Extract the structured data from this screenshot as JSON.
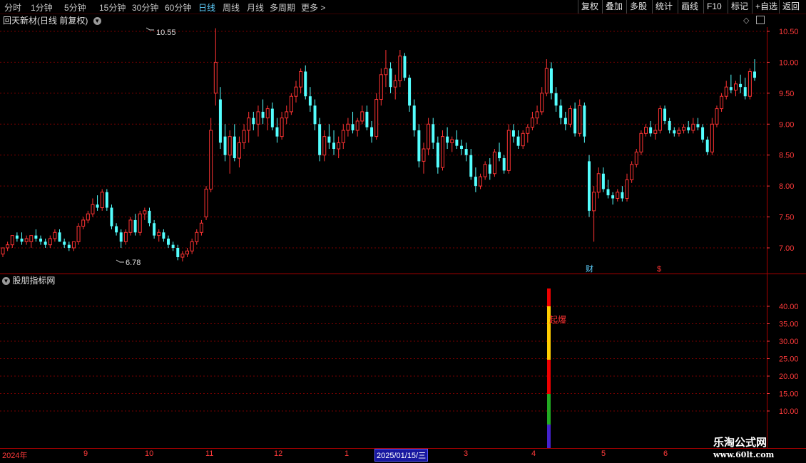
{
  "toolbar": {
    "periods": [
      "分时",
      "1分钟",
      "5分钟",
      "15分钟",
      "30分钟",
      "60分钟",
      "日线",
      "周线",
      "月线",
      "多周期",
      "更多 >"
    ],
    "active": "日线",
    "actions": [
      "复权",
      "叠加",
      "多股",
      "统计",
      "画线",
      "F10",
      "标记",
      "+自选",
      "返回"
    ]
  },
  "main": {
    "title": "回天新材(日线 前复权)",
    "price_labels": [
      "10.50",
      "10.00",
      "9.50",
      "9.00",
      "8.50",
      "8.00",
      "7.50",
      "7.00"
    ],
    "high_note": "10.55",
    "low_note": "6.78",
    "markers": [
      "财",
      "$"
    ]
  },
  "indicator": {
    "title": "股朋指标网",
    "labels": [
      "40.00",
      "35.00",
      "30.00",
      "25.00",
      "20.00",
      "15.00",
      "10.00"
    ],
    "signal_text": "起爆"
  },
  "xaxis": {
    "labels": [
      "2024年",
      "9",
      "10",
      "11",
      "12",
      "1",
      "2025/01/15/三",
      "3",
      "4",
      "5",
      "6"
    ]
  },
  "watermark": {
    "line1": "乐淘公式网",
    "line2": "www.60lt.com"
  },
  "colors": {
    "up": "#ff3333",
    "down": "#54ffff",
    "axis": "#ff3a3a",
    "grid": "#7a0000"
  },
  "candles": [
    [
      6.9,
      7.0,
      6.85,
      7.0
    ],
    [
      7.0,
      7.1,
      6.95,
      7.05
    ],
    [
      7.05,
      7.2,
      7.0,
      7.2
    ],
    [
      7.2,
      7.25,
      7.1,
      7.15
    ],
    [
      7.15,
      7.25,
      7.05,
      7.1
    ],
    [
      7.1,
      7.2,
      7.05,
      7.15
    ],
    [
      7.1,
      7.2,
      7.0,
      7.2
    ],
    [
      7.2,
      7.3,
      7.1,
      7.15
    ],
    [
      7.15,
      7.2,
      7.05,
      7.1
    ],
    [
      7.1,
      7.15,
      7.0,
      7.05
    ],
    [
      7.05,
      7.2,
      7.0,
      7.15
    ],
    [
      7.15,
      7.3,
      7.1,
      7.25
    ],
    [
      7.25,
      7.3,
      7.1,
      7.1
    ],
    [
      7.1,
      7.15,
      7.0,
      7.05
    ],
    [
      7.05,
      7.1,
      6.95,
      7.0
    ],
    [
      7.0,
      7.1,
      6.95,
      7.1
    ],
    [
      7.1,
      7.4,
      7.05,
      7.35
    ],
    [
      7.35,
      7.5,
      7.3,
      7.45
    ],
    [
      7.45,
      7.6,
      7.4,
      7.55
    ],
    [
      7.55,
      7.8,
      7.5,
      7.7
    ],
    [
      7.7,
      7.85,
      7.6,
      7.65
    ],
    [
      7.65,
      7.95,
      7.6,
      7.9
    ],
    [
      7.9,
      7.95,
      7.6,
      7.65
    ],
    [
      7.65,
      7.7,
      7.3,
      7.35
    ],
    [
      7.35,
      7.4,
      7.2,
      7.25
    ],
    [
      7.25,
      7.3,
      7.0,
      7.1
    ],
    [
      7.1,
      7.3,
      7.05,
      7.25
    ],
    [
      7.25,
      7.5,
      7.2,
      7.45
    ],
    [
      7.45,
      7.55,
      7.2,
      7.25
    ],
    [
      7.25,
      7.6,
      7.2,
      7.55
    ],
    [
      7.55,
      7.65,
      7.45,
      7.6
    ],
    [
      7.6,
      7.65,
      7.35,
      7.4
    ],
    [
      7.4,
      7.45,
      7.15,
      7.2
    ],
    [
      7.2,
      7.3,
      7.1,
      7.25
    ],
    [
      7.25,
      7.3,
      7.1,
      7.15
    ],
    [
      7.15,
      7.2,
      7.0,
      7.05
    ],
    [
      7.05,
      7.1,
      6.95,
      7.0
    ],
    [
      7.0,
      7.05,
      6.8,
      6.85
    ],
    [
      6.85,
      6.95,
      6.78,
      6.9
    ],
    [
      6.9,
      7.0,
      6.85,
      6.95
    ],
    [
      6.95,
      7.15,
      6.9,
      7.1
    ],
    [
      7.1,
      7.3,
      7.05,
      7.25
    ],
    [
      7.25,
      7.45,
      7.2,
      7.4
    ],
    [
      7.5,
      8.0,
      7.45,
      7.95
    ],
    [
      7.95,
      9.1,
      7.9,
      8.9
    ],
    [
      9.5,
      10.55,
      9.3,
      10.0
    ],
    [
      9.4,
      9.6,
      8.6,
      8.7
    ],
    [
      8.8,
      9.0,
      8.4,
      8.5
    ],
    [
      8.5,
      8.9,
      8.2,
      8.8
    ],
    [
      8.8,
      9.0,
      8.4,
      8.45
    ],
    [
      8.45,
      8.8,
      8.3,
      8.7
    ],
    [
      8.7,
      9.0,
      8.6,
      8.9
    ],
    [
      8.9,
      9.2,
      8.7,
      9.1
    ],
    [
      9.1,
      9.2,
      8.9,
      9.0
    ],
    [
      9.0,
      9.3,
      8.8,
      9.2
    ],
    [
      9.2,
      9.4,
      9.0,
      9.1
    ],
    [
      9.1,
      9.3,
      8.9,
      9.25
    ],
    [
      9.25,
      9.35,
      8.9,
      8.95
    ],
    [
      8.95,
      9.1,
      8.7,
      8.8
    ],
    [
      8.8,
      9.2,
      8.75,
      9.1
    ],
    [
      9.1,
      9.3,
      9.0,
      9.2
    ],
    [
      9.2,
      9.5,
      9.15,
      9.45
    ],
    [
      9.45,
      9.7,
      9.35,
      9.6
    ],
    [
      9.6,
      9.9,
      9.5,
      9.85
    ],
    [
      9.85,
      9.95,
      9.4,
      9.45
    ],
    [
      9.45,
      9.6,
      9.2,
      9.3
    ],
    [
      9.3,
      9.4,
      8.9,
      9.0
    ],
    [
      9.0,
      9.1,
      8.4,
      8.5
    ],
    [
      8.5,
      8.9,
      8.4,
      8.8
    ],
    [
      8.8,
      9.0,
      8.6,
      8.7
    ],
    [
      8.7,
      8.9,
      8.5,
      8.6
    ],
    [
      8.6,
      8.8,
      8.45,
      8.7
    ],
    [
      8.7,
      9.0,
      8.6,
      8.9
    ],
    [
      8.9,
      9.1,
      8.8,
      9.0
    ],
    [
      9.0,
      9.2,
      8.85,
      8.9
    ],
    [
      8.9,
      9.1,
      8.8,
      9.05
    ],
    [
      9.05,
      9.3,
      9.0,
      9.2
    ],
    [
      9.2,
      9.3,
      8.9,
      8.95
    ],
    [
      8.95,
      9.05,
      8.7,
      8.8
    ],
    [
      8.8,
      9.5,
      8.75,
      9.4
    ],
    [
      9.4,
      9.9,
      9.3,
      9.8
    ],
    [
      9.8,
      10.2,
      9.6,
      9.9
    ],
    [
      9.9,
      10.0,
      9.5,
      9.6
    ],
    [
      9.6,
      9.8,
      9.4,
      9.7
    ],
    [
      9.7,
      10.2,
      9.6,
      10.1
    ],
    [
      10.1,
      10.15,
      9.7,
      9.75
    ],
    [
      9.75,
      9.8,
      9.2,
      9.3
    ],
    [
      9.3,
      9.4,
      8.8,
      8.9
    ],
    [
      8.9,
      9.0,
      8.3,
      8.4
    ],
    [
      8.4,
      8.7,
      8.2,
      8.6
    ],
    [
      8.6,
      9.1,
      8.5,
      9.0
    ],
    [
      9.0,
      9.1,
      8.6,
      8.7
    ],
    [
      8.7,
      8.8,
      8.2,
      8.3
    ],
    [
      8.3,
      8.9,
      8.25,
      8.8
    ],
    [
      8.8,
      8.95,
      8.6,
      8.7
    ],
    [
      8.7,
      8.8,
      8.55,
      8.75
    ],
    [
      8.75,
      8.9,
      8.6,
      8.65
    ],
    [
      8.65,
      8.75,
      8.5,
      8.6
    ],
    [
      8.6,
      8.7,
      8.4,
      8.5
    ],
    [
      8.5,
      8.6,
      8.1,
      8.15
    ],
    [
      8.15,
      8.3,
      7.9,
      8.0
    ],
    [
      8.0,
      8.2,
      7.95,
      8.15
    ],
    [
      8.15,
      8.4,
      8.1,
      8.35
    ],
    [
      8.35,
      8.45,
      8.1,
      8.2
    ],
    [
      8.2,
      8.6,
      8.15,
      8.55
    ],
    [
      8.55,
      8.7,
      8.4,
      8.45
    ],
    [
      8.45,
      8.5,
      8.2,
      8.25
    ],
    [
      8.25,
      9.0,
      8.2,
      8.9
    ],
    [
      8.9,
      9.0,
      8.7,
      8.8
    ],
    [
      8.8,
      8.9,
      8.6,
      8.65
    ],
    [
      8.65,
      8.9,
      8.6,
      8.85
    ],
    [
      8.85,
      9.0,
      8.7,
      8.95
    ],
    [
      8.95,
      9.2,
      8.9,
      9.1
    ],
    [
      9.1,
      9.3,
      9.0,
      9.2
    ],
    [
      9.2,
      9.6,
      9.15,
      9.5
    ],
    [
      9.5,
      10.05,
      9.45,
      9.9
    ],
    [
      9.9,
      10.0,
      9.4,
      9.5
    ],
    [
      9.5,
      9.6,
      9.2,
      9.3
    ],
    [
      9.3,
      9.4,
      9.0,
      9.1
    ],
    [
      9.1,
      9.2,
      8.9,
      9.0
    ],
    [
      9.0,
      9.3,
      8.95,
      9.25
    ],
    [
      9.25,
      9.35,
      8.8,
      8.85
    ],
    [
      8.85,
      9.4,
      8.8,
      9.3
    ],
    [
      9.3,
      9.35,
      8.7,
      8.8
    ],
    [
      8.4,
      8.5,
      7.5,
      7.6
    ],
    [
      7.6,
      8.0,
      7.1,
      7.9
    ],
    [
      7.9,
      8.3,
      7.8,
      8.2
    ],
    [
      8.2,
      8.3,
      7.9,
      7.95
    ],
    [
      7.95,
      8.1,
      7.8,
      7.85
    ],
    [
      7.85,
      7.9,
      7.7,
      7.8
    ],
    [
      7.8,
      7.95,
      7.75,
      7.9
    ],
    [
      7.9,
      8.0,
      7.75,
      7.8
    ],
    [
      7.8,
      8.2,
      7.75,
      8.1
    ],
    [
      8.1,
      8.4,
      8.05,
      8.35
    ],
    [
      8.35,
      8.6,
      8.3,
      8.55
    ],
    [
      8.55,
      8.9,
      8.5,
      8.85
    ],
    [
      8.85,
      9.0,
      8.8,
      8.95
    ],
    [
      8.95,
      9.05,
      8.8,
      8.85
    ],
    [
      8.85,
      9.0,
      8.75,
      8.9
    ],
    [
      8.9,
      9.3,
      8.85,
      9.25
    ],
    [
      9.25,
      9.3,
      9.0,
      9.05
    ],
    [
      9.05,
      9.1,
      8.85,
      8.9
    ],
    [
      8.9,
      8.95,
      8.8,
      8.85
    ],
    [
      8.85,
      8.95,
      8.8,
      8.9
    ],
    [
      8.9,
      9.0,
      8.85,
      8.95
    ],
    [
      8.95,
      9.05,
      8.85,
      8.9
    ],
    [
      8.9,
      9.1,
      8.85,
      9.0
    ],
    [
      9.0,
      9.1,
      8.9,
      8.95
    ],
    [
      8.95,
      9.0,
      8.7,
      8.75
    ],
    [
      8.75,
      8.8,
      8.5,
      8.55
    ],
    [
      8.55,
      9.1,
      8.5,
      9.0
    ],
    [
      9.0,
      9.3,
      8.95,
      9.25
    ],
    [
      9.25,
      9.5,
      9.2,
      9.45
    ],
    [
      9.45,
      9.7,
      9.4,
      9.6
    ],
    [
      9.6,
      9.8,
      9.5,
      9.55
    ],
    [
      9.55,
      9.7,
      9.45,
      9.65
    ],
    [
      9.65,
      9.8,
      9.5,
      9.6
    ],
    [
      9.6,
      9.75,
      9.4,
      9.45
    ],
    [
      9.45,
      9.9,
      9.4,
      9.85
    ],
    [
      9.85,
      10.05,
      9.7,
      9.75
    ]
  ]
}
